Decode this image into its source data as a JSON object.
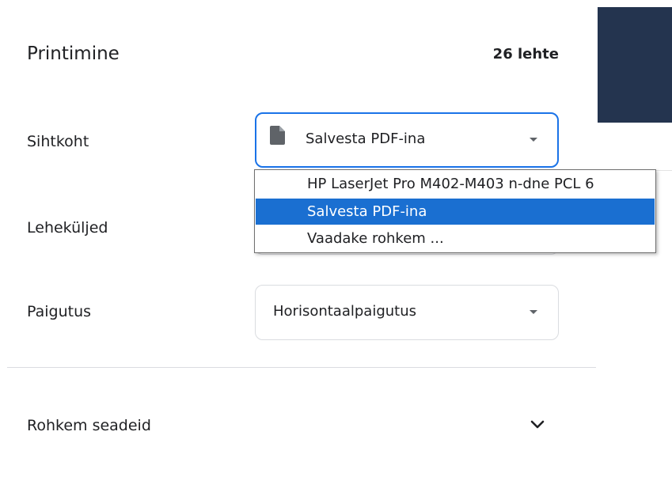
{
  "header": {
    "title": "Printimine",
    "sheet_count": "26 lehte"
  },
  "destination": {
    "label": "Sihtkoht",
    "value": "Salvesta PDF-ina",
    "icon": "document-icon"
  },
  "pages": {
    "label": "Leheküljed"
  },
  "layout": {
    "label": "Paigutus",
    "value": "Horisontaalpaigutus"
  },
  "more_settings": {
    "label": "Rohkem seadeid",
    "icon": "chevron-down-icon"
  },
  "dropdown": {
    "options": [
      "HP LaserJet Pro M402-M403 n-dne PCL 6",
      "Salvesta PDF-ina",
      "Vaadake rohkem ..."
    ],
    "selected_index": 1
  },
  "colors": {
    "focus_border": "#1a73e8",
    "selected_option": "#1a6fd1",
    "preview_dark": "#24344f"
  }
}
